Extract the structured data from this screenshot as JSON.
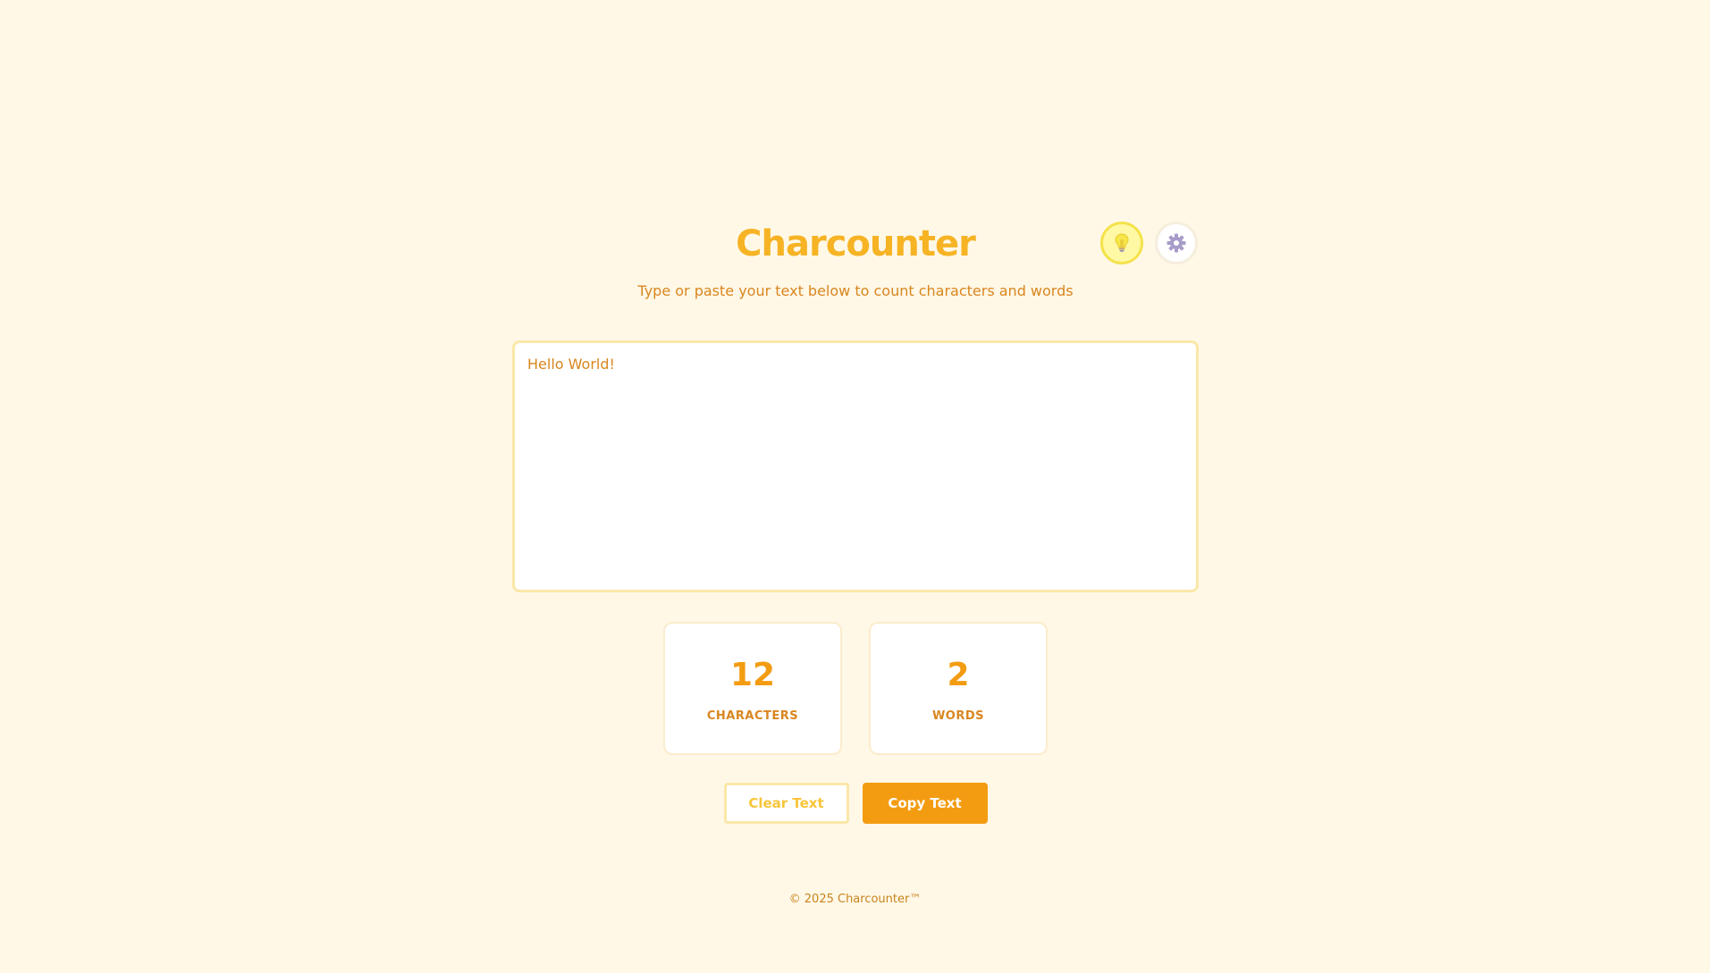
{
  "app": {
    "title": "Charcounter",
    "subtitle": "Type or paste your text below to count characters and words"
  },
  "header_icons": {
    "theme_icon": "lightbulb-icon",
    "settings_icon": "gear-icon"
  },
  "editor": {
    "value": "Hello World!",
    "placeholder": ""
  },
  "stats": {
    "characters": {
      "value": "12",
      "label": "CHARACTERS"
    },
    "words": {
      "value": "2",
      "label": "WORDS"
    }
  },
  "actions": {
    "clear_label": "Clear Text",
    "copy_label": "Copy Text"
  },
  "footer": {
    "text": "© 2025 Charcounter™"
  },
  "colors": {
    "background": "#fff8e7",
    "title": "#f6b324",
    "accent": "#f39c12",
    "text": "#d9861f",
    "border": "#fbe7a8"
  }
}
